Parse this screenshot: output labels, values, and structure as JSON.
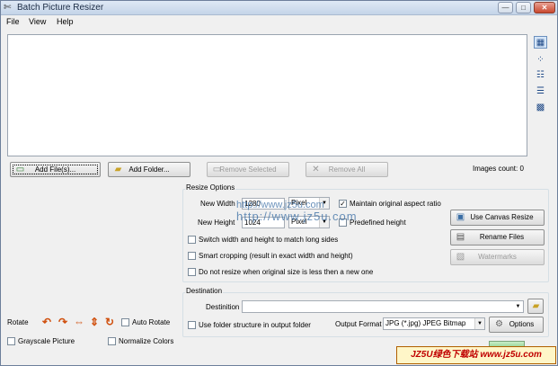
{
  "window": {
    "title": "Batch Picture Resizer",
    "minimize": "—",
    "maximize": "□",
    "close": "✕"
  },
  "menu": [
    {
      "label": "File"
    },
    {
      "label": "View"
    },
    {
      "label": "Help"
    }
  ],
  "view_icons": [
    "view-large-icons-icon",
    "view-small-icons-icon",
    "view-list-icon",
    "view-details-icon",
    "view-tiles-icon"
  ],
  "file_buttons": {
    "add_files": "Add File(s)...",
    "add_folder": "Add Folder...",
    "remove_selected": "Remove Selected",
    "remove_all": "Remove All"
  },
  "images_count": "Images count: 0",
  "resize_options": {
    "title": "Resize Options",
    "new_width_label": "New Width",
    "new_width_value": "1280",
    "new_height_label": "New Height",
    "new_height_value": "1024",
    "unit": "Pixel",
    "unit_height": "Pixel",
    "maintain_aspect": "Maintain original aspect ratio",
    "predefined_height": "Predefined height",
    "switch_wh": "Switch width and height to match long sides",
    "smart_crop": "Smart cropping (result in exact width and height)",
    "no_resize_smaller": "Do not resize when original size is less then a new one",
    "canvas_resize": "Use Canvas Resize",
    "rename_files": "Rename Files",
    "watermarks": "Watermarks"
  },
  "watermark_overlay": {
    "line1": "http://www.jz5u.com",
    "line2": "http://www.jz5u.com"
  },
  "left_panel": {
    "rotate_label": "Rotate",
    "auto_rotate": "Auto Rotate",
    "grayscale": "Grayscale Picture",
    "normalize": "Normalize Colors"
  },
  "destination": {
    "title": "Destination",
    "destination_label": "Destinition",
    "destination_value": "",
    "folder_structure": "Use folder structure in output folder",
    "output_format_label": "Output Format",
    "output_format_value": "JPG (*.jpg) JPEG Bitmap",
    "options": "Options"
  },
  "site_banner": "JZ5U绿色下载站 www.jz5u.com",
  "colors": {
    "accent": "#6b8fbd",
    "rotate_icons": "#d0500e"
  }
}
